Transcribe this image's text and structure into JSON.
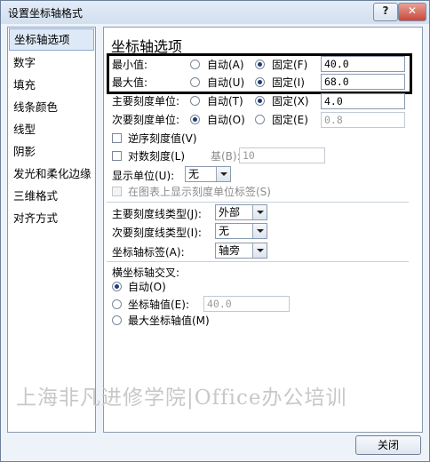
{
  "window": {
    "title": "设置坐标轴格式",
    "help_label": "?",
    "close_label": "✕"
  },
  "nav": {
    "items": [
      {
        "label": "坐标轴选项",
        "selected": true
      },
      {
        "label": "数字"
      },
      {
        "label": "填充"
      },
      {
        "label": "线条颜色"
      },
      {
        "label": "线型"
      },
      {
        "label": "阴影"
      },
      {
        "label": "发光和柔化边缘"
      },
      {
        "label": "三维格式"
      },
      {
        "label": "对齐方式"
      }
    ]
  },
  "panel": {
    "title": "坐标轴选项",
    "rows": {
      "min": {
        "label": "最小值:",
        "auto": "自动(A)",
        "fixed": "固定(F)",
        "value": "40.0",
        "selected": "fixed"
      },
      "max": {
        "label": "最大值:",
        "auto": "自动(U)",
        "fixed": "固定(I)",
        "value": "68.0",
        "selected": "fixed"
      },
      "major": {
        "label": "主要刻度单位:",
        "auto": "自动(T)",
        "fixed": "固定(X)",
        "value": "4.0",
        "selected": "fixed"
      },
      "minor": {
        "label": "次要刻度单位:",
        "auto": "自动(O)",
        "fixed": "固定(E)",
        "value": "0.8",
        "selected": "auto"
      }
    },
    "reverse": "逆序刻度值(V)",
    "log": "对数刻度(L)",
    "log_base_label": "基(B):",
    "log_base_value": "10",
    "display_unit_label": "显示单位(U):",
    "display_unit_value": "无",
    "show_unit_label": "在图表上显示刻度单位标签(S)",
    "major_tick_label": "主要刻度线类型(J):",
    "major_tick_value": "外部",
    "minor_tick_label": "次要刻度线类型(I):",
    "minor_tick_value": "无",
    "axis_labels_label": "坐标轴标签(A):",
    "axis_labels_value": "轴旁",
    "cross_title": "横坐标轴交叉:",
    "cross_auto": "自动(O)",
    "cross_value_label": "坐标轴值(E):",
    "cross_value": "40.0",
    "cross_max": "最大坐标轴值(M)"
  },
  "watermark": "上海非凡进修学院|Office办公培训",
  "footer": {
    "close_button": "关闭"
  }
}
